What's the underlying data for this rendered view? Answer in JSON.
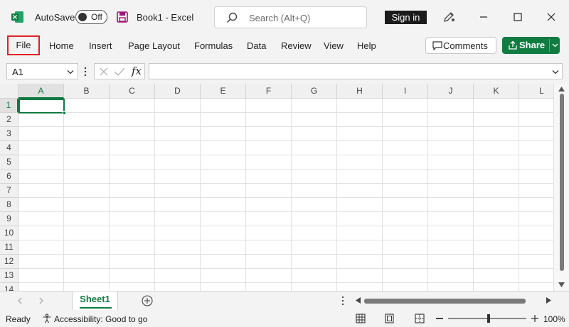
{
  "titlebar": {
    "autosave_label": "AutoSave",
    "autosave_state": "Off",
    "doc_title": "Book1  -  Excel",
    "search_placeholder": "Search (Alt+Q)",
    "signin_label": "Sign in",
    "icons": [
      "excel-logo-icon",
      "save-icon",
      "search-icon",
      "pen-icon",
      "minimize-icon",
      "maximize-icon",
      "close-icon"
    ],
    "brand_color": "#107c41"
  },
  "ribbon": {
    "tabs": [
      "File",
      "Home",
      "Insert",
      "Page Layout",
      "Formulas",
      "Data",
      "Review",
      "View",
      "Help"
    ],
    "highlighted_tab": "File",
    "highlight_color": "#e02020",
    "comments_label": "Comments",
    "share_label": "Share"
  },
  "formula_bar": {
    "name_box": "A1",
    "fx_label": "fx",
    "formula_value": ""
  },
  "grid": {
    "columns": [
      "A",
      "B",
      "C",
      "D",
      "E",
      "F",
      "G",
      "H",
      "I",
      "J",
      "K",
      "L"
    ],
    "rows": [
      "1",
      "2",
      "3",
      "4",
      "5",
      "6",
      "7",
      "8",
      "9",
      "10",
      "11",
      "12",
      "13",
      "14"
    ],
    "active_cell": "A1"
  },
  "sheets": {
    "tabs": [
      "Sheet1"
    ],
    "active": "Sheet1"
  },
  "statusbar": {
    "ready": "Ready",
    "accessibility": "Accessibility: Good to go",
    "zoom": "100%"
  }
}
